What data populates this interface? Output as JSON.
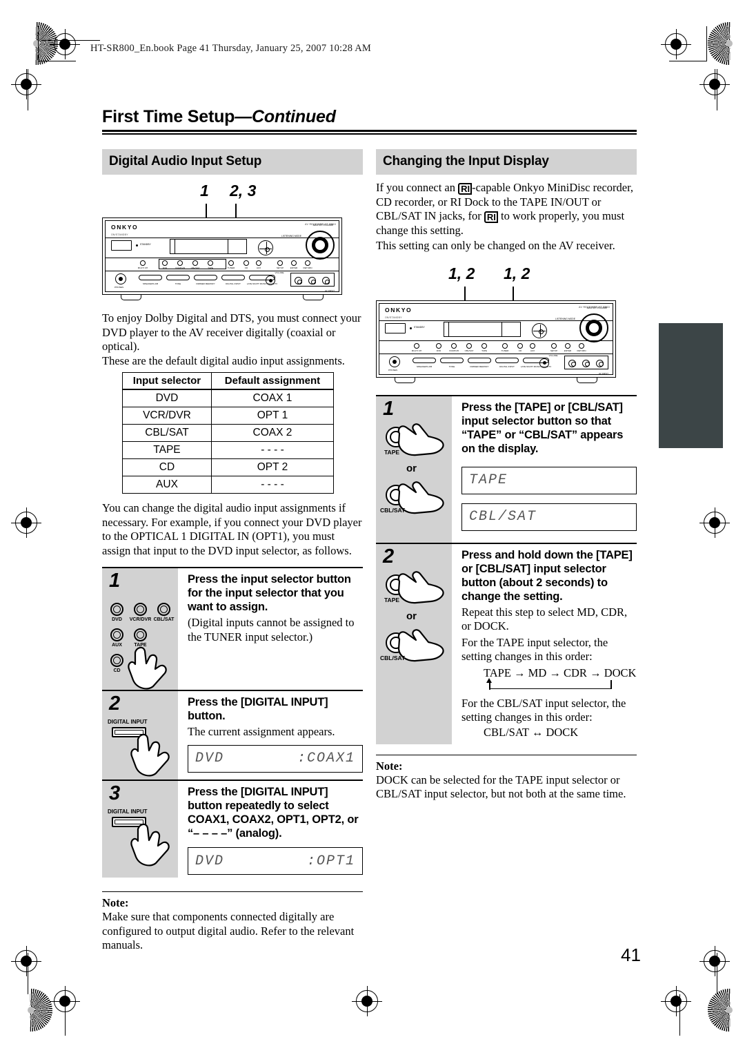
{
  "file_header": "HT-SR800_En.book  Page 41  Thursday, January 25, 2007  10:28 AM",
  "page_number": "41",
  "chapter_title_main": "First Time Setup",
  "chapter_title_cont": "—Continued",
  "left_column": {
    "section_heading": "Digital Audio Input Setup",
    "diagram": {
      "callout_1": "1",
      "callout_2": "2, 3",
      "brand": "ONKYO",
      "model_right": "AV RECEIVER HT-R560",
      "standby_label": "STANDBY",
      "sub_label": "ON/STANDBY",
      "listening_mode_label": "LISTENING MODE",
      "master_volume_label": "MASTER VOLUME",
      "phones_label": "PHONES",
      "volume_label": "VOLUME",
      "av_input_label": "AV INPUT",
      "jack_labels": [
        "VIDEO",
        "L  -AUDIO-  R"
      ],
      "top_buttons": [
        "MULTI CH",
        "DVD",
        "VCR/DVR",
        "CBL/SAT",
        "TAPE",
        "TUNER",
        "CD",
        "AUX"
      ],
      "right_buttons": [
        "SETUP",
        "ENTER",
        "RETURN"
      ],
      "bottom_buttons": [
        "SPEAKERS A/B",
        "TONE",
        "DIMMER",
        "MEMORY",
        "DIGITAL INPUT",
        "LATE NIGHT",
        "MUSIC",
        "MOVIE/TV"
      ]
    },
    "intro_paragraph_1": "To enjoy Dolby Digital and DTS, you must connect your DVD player to the AV receiver digitally (coaxial or optical).",
    "intro_paragraph_2": "These are the default digital audio input assignments.",
    "table": {
      "headers": [
        "Input selector",
        "Default assignment"
      ],
      "rows": [
        [
          "DVD",
          "COAX 1"
        ],
        [
          "VCR/DVR",
          "OPT 1"
        ],
        [
          "CBL/SAT",
          "COAX 2"
        ],
        [
          "TAPE",
          "- - - -"
        ],
        [
          "CD",
          "OPT 2"
        ],
        [
          "AUX",
          "- - - -"
        ]
      ]
    },
    "after_table_paragraph": "You can change the digital audio input assignments if necessary. For example, if you connect your DVD player to the OPTICAL 1 DIGITAL IN (OPT1), you must assign that input to the DVD input selector, as follows.",
    "steps": [
      {
        "number": "1",
        "title": "Press the input selector button for the input selector that you want to assign.",
        "desc": "(Digital inputs cannot be assigned to the TUNER input selector.)",
        "button_labels": [
          "DVD",
          "VCR/DVR",
          "CBL/SAT",
          "AUX",
          "TAPE",
          "CD"
        ]
      },
      {
        "number": "2",
        "title": "Press the [DIGITAL INPUT] button.",
        "desc": "The current assignment appears.",
        "button_label": "DIGITAL INPUT",
        "lcd_left": "DVD",
        "lcd_right": ":COAX1"
      },
      {
        "number": "3",
        "title": "Press the [DIGITAL INPUT] button repeatedly to select COAX1, COAX2, OPT1, OPT2, or “– – – –” (analog).",
        "button_label": "DIGITAL INPUT",
        "lcd_left": "DVD",
        "lcd_right": ":OPT1"
      }
    ],
    "note_label": "Note:",
    "note_text": "Make sure that components connected digitally are configured to output digital audio. Refer to the relevant manuals."
  },
  "right_column": {
    "section_heading": "Changing the Input Display",
    "intro_part_1": "If you connect an ",
    "ri_glyph": "RI",
    "intro_part_2": "-capable Onkyo MiniDisc recorder, CD recorder, or RI Dock to the TAPE IN/OUT or CBL/SAT IN jacks, for ",
    "intro_part_3": " to work properly, you must change this setting.",
    "intro_paragraph_2": "This setting can only be changed on the AV receiver.",
    "diagram": {
      "callout_left": "1, 2",
      "callout_right": "1, 2",
      "brand": "ONKYO"
    },
    "steps": [
      {
        "number": "1",
        "title": "Press the [TAPE] or [CBL/SAT] input selector button so that “TAPE” or “CBL/SAT” appears on the display.",
        "button_a": "TAPE",
        "or_label": "or",
        "button_b": "CBL/SAT",
        "lcd_1": "TAPE",
        "lcd_2": "CBL/SAT"
      },
      {
        "number": "2",
        "title": "Press and hold down the [TAPE] or [CBL/SAT] input selector button (about 2 seconds) to change the setting.",
        "button_a": "TAPE",
        "or_label": "or",
        "button_b": "CBL/SAT",
        "desc_1": "Repeat this step to select MD, CDR, or DOCK.",
        "desc_2": "For the TAPE input selector, the setting changes in this order:",
        "flow_1": "TAPE → MD → CDR → DOCK",
        "desc_3": "For the CBL/SAT input selector, the setting changes in this order:",
        "flow_2": "CBL/SAT ↔ DOCK"
      }
    ],
    "note_label": "Note:",
    "note_text": "DOCK can be selected for the TAPE input selector or CBL/SAT input selector, but not both at the same time."
  },
  "colors": {
    "section_heading_bg": "#d2d2d2",
    "step_column_bg": "#d2d2d2",
    "side_tab": "#3c4547",
    "lcd_text": "#555555"
  }
}
